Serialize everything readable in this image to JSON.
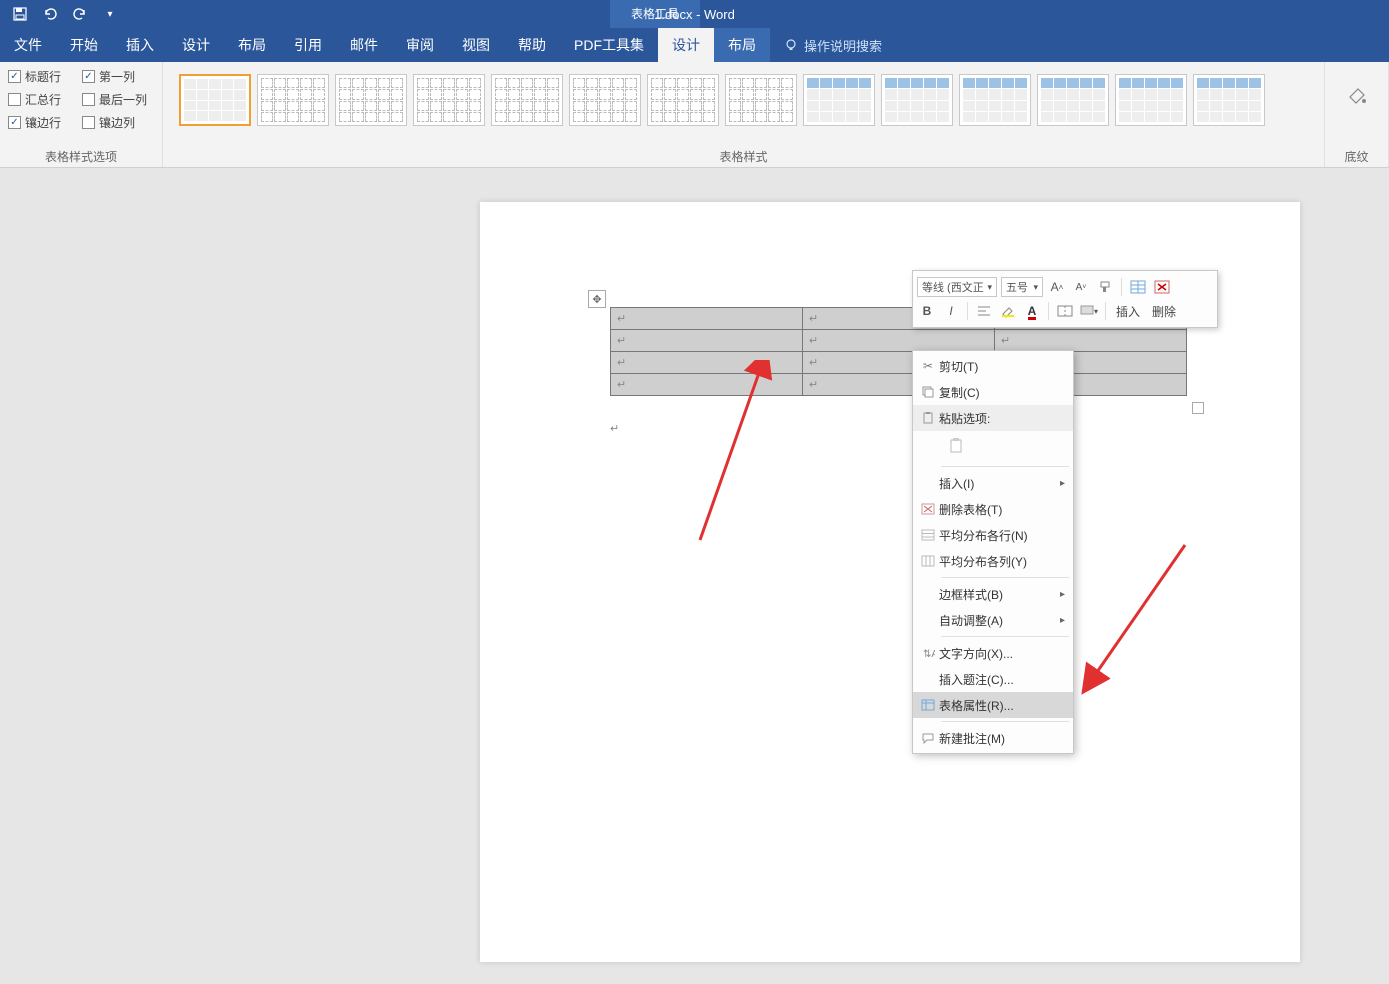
{
  "title": {
    "context_tab": "表格工具",
    "document": "1.docx - Word"
  },
  "qat": {
    "save": "保存",
    "undo": "撤销",
    "redo": "重做"
  },
  "tabs": {
    "file": "文件",
    "home": "开始",
    "insert": "插入",
    "design": "设计",
    "layout": "布局",
    "references": "引用",
    "mailings": "邮件",
    "review": "审阅",
    "view": "视图",
    "help": "帮助",
    "pdf": "PDF工具集",
    "table_design": "设计",
    "table_layout": "布局",
    "tell_me": "操作说明搜索"
  },
  "ribbon": {
    "options_group_label": "表格样式选项",
    "header_row": "标题行",
    "first_column": "第一列",
    "total_row": "汇总行",
    "last_column": "最后一列",
    "banded_rows": "镶边行",
    "banded_columns": "镶边列",
    "styles_group_label": "表格样式",
    "shading_label": "底纹"
  },
  "mini_toolbar": {
    "font_name": "等线 (西文正",
    "font_size": "五号",
    "insert": "插入",
    "delete": "删除"
  },
  "context_menu": {
    "cut": "剪切(T)",
    "copy": "复制(C)",
    "paste_options": "粘贴选项:",
    "insert": "插入(I)",
    "delete_table": "删除表格(T)",
    "distribute_rows": "平均分布各行(N)",
    "distribute_cols": "平均分布各列(Y)",
    "border_styles": "边框样式(B)",
    "autofit": "自动调整(A)",
    "text_direction": "文字方向(X)...",
    "insert_caption": "插入题注(C)...",
    "table_properties": "表格属性(R)...",
    "new_comment": "新建批注(M)"
  }
}
